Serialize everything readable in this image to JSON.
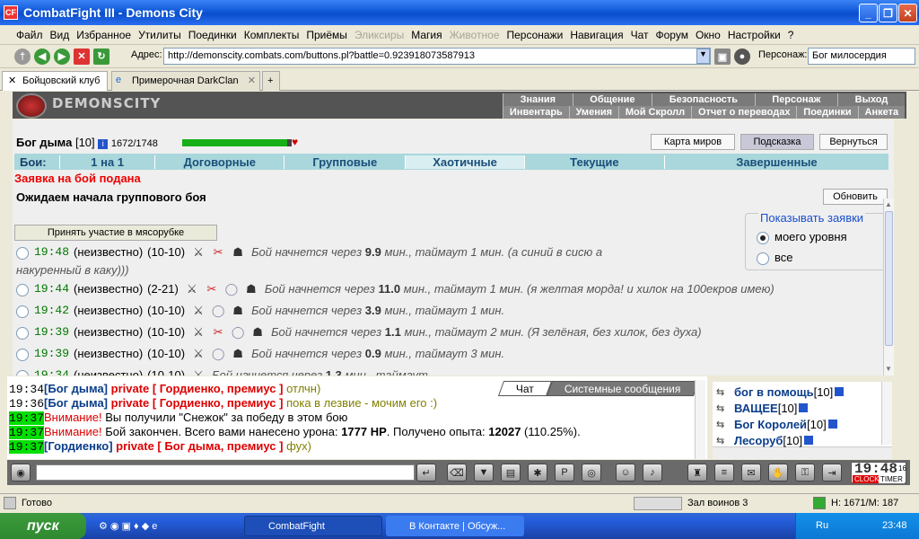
{
  "window": {
    "title": "CombatFight III - Demons City"
  },
  "menu": [
    {
      "label": "Файл",
      "disabled": false
    },
    {
      "label": "Вид",
      "disabled": false
    },
    {
      "label": "Избранное",
      "disabled": false
    },
    {
      "label": "Утилиты",
      "disabled": false
    },
    {
      "label": "Поединки",
      "disabled": false
    },
    {
      "label": "Комплекты",
      "disabled": false
    },
    {
      "label": "Приёмы",
      "disabled": false
    },
    {
      "label": "Эликсиры",
      "disabled": true
    },
    {
      "label": "Магия",
      "disabled": false
    },
    {
      "label": "Животное",
      "disabled": true
    },
    {
      "label": "Персонажи",
      "disabled": false
    },
    {
      "label": "Навигация",
      "disabled": false
    },
    {
      "label": "Чат",
      "disabled": false
    },
    {
      "label": "Форум",
      "disabled": false
    },
    {
      "label": "Окно",
      "disabled": false
    },
    {
      "label": "Настройки",
      "disabled": false
    },
    {
      "label": "?",
      "disabled": false
    }
  ],
  "toolbar": {
    "address_label": "Адрес:",
    "address": "http://demonscity.combats.com/buttons.pl?battle=0.923918073587913",
    "persona_label": "Персонаж:",
    "persona": "Бог милосердия"
  },
  "tabs": [
    {
      "label": "Бойцовский клуб",
      "active": true
    },
    {
      "label": "Примерочная DarkClan",
      "active": false
    }
  ],
  "site": {
    "logo": "DEMONSCITY",
    "nav1": [
      "Знания",
      "Общение",
      "Безопасность",
      "Персонаж",
      "Выход"
    ],
    "nav2": [
      "Инвентарь",
      "Умения",
      "Мой Скролл",
      "Отчет о переводах",
      "Поединки",
      "Анкета"
    ]
  },
  "player": {
    "name": "Бог дыма",
    "level": "[10]",
    "info_icon": "i",
    "hp": "1672/1748",
    "hp_fraction": 0.956,
    "heart": "♥"
  },
  "buttons": {
    "map": "Карта миров",
    "hint": "Подсказка",
    "back": "Вернуться",
    "refresh": "Обновить",
    "join": "Принять участие в мясорубке"
  },
  "fight_tabs": {
    "label": "Бои:",
    "items": [
      "1 на 1",
      "Договорные",
      "Групповые",
      "Хаотичные",
      "Текущие",
      "Завершенные"
    ],
    "active": 3
  },
  "status": {
    "submitted": "Заявка на бой подана",
    "waiting": "Ожидаем начала группового боя"
  },
  "filter": {
    "title": "Показывать заявки",
    "options": [
      "моего уровня",
      "все"
    ],
    "selected": 0
  },
  "requests": [
    {
      "time": "19:48",
      "who": "(неизвестно)",
      "levels": "(10-10)",
      "icons": [
        "crossed-swords",
        "blade-red",
        "helmet-dark"
      ],
      "pre": "Бой начнется через ",
      "num": "9.9",
      "post": " мин., таймаут 1 мин. (а синий в сисю а",
      "line2": "накуренный в каку)))"
    },
    {
      "time": "19:44",
      "who": "(неизвестно)",
      "levels": "(2-21)",
      "icons": [
        "crossed-swords",
        "blade-red",
        "orb",
        "helmet-dark"
      ],
      "pre": "Бой начнется через ",
      "num": "11.0",
      "post": " мин., таймаут 1 мин. (я желтая морда! и хилок на 100екров имею)",
      "line2": ""
    },
    {
      "time": "19:42",
      "who": "(неизвестно)",
      "levels": "(10-10)",
      "icons": [
        "crossed-swords",
        "orb",
        "helmet-dark"
      ],
      "pre": "Бой начнется через ",
      "num": "3.9",
      "post": " мин., таймаут 1 мин.",
      "line2": ""
    },
    {
      "time": "19:39",
      "who": "(неизвестно)",
      "levels": "(10-10)",
      "icons": [
        "crossed-swords",
        "blade-red",
        "orb",
        "helmet-dark"
      ],
      "pre": "Бой начнется через ",
      "num": "1.1",
      "post": " мин., таймаут 2 мин. (Я зелёная, без хилок, без духа)",
      "line2": ""
    },
    {
      "time": "19:39",
      "who": "(неизвестно)",
      "levels": "(10-10)",
      "icons": [
        "crossed-swords",
        "orb",
        "helmet-dark"
      ],
      "pre": "Бой начнется через ",
      "num": "0.9",
      "post": " мин., таймаут 3 мин.",
      "line2": ""
    },
    {
      "time": "19:34",
      "who": "(неизвестно)",
      "levels": "(10-10)",
      "icons": [
        "crossed-swords"
      ],
      "pre": "Бой начнется через ",
      "num": "1.3",
      "post": " мин., таймаут",
      "line2": ""
    }
  ],
  "chat": {
    "tabs": [
      "Чат",
      "Системные сообщения"
    ],
    "lines": [
      {
        "time": "19:34",
        "hl": false,
        "parts": [
          {
            "t": "[Бог дыма]",
            "c": "bl"
          },
          {
            "t": " private [ Гордиенко, премиус ]",
            "c": "rd"
          },
          {
            "t": " отлчн)",
            "c": "ol"
          }
        ]
      },
      {
        "time": "19:36",
        "hl": false,
        "parts": [
          {
            "t": "[Бог дыма]",
            "c": "bl"
          },
          {
            "t": " private [ Гордиенко, премиус ]",
            "c": "rd"
          },
          {
            "t": " пока в лезвие - мочим его :)",
            "c": "ol"
          }
        ]
      },
      {
        "time": "19:37",
        "hl": true,
        "parts": [
          {
            "t": "Внимание!",
            "c": "rdn"
          },
          {
            "t": " Вы получили \"Снежок\" за победу в этом бою",
            "c": ""
          }
        ]
      },
      {
        "time": "19:37",
        "hl": true,
        "parts": [
          {
            "t": "Внимание!",
            "c": "rdn"
          },
          {
            "t": " Бой закончен. Всего вами нанесено урона: ",
            "c": ""
          },
          {
            "t": "1777 HP",
            "c": "b"
          },
          {
            "t": ". Получено опыта: ",
            "c": ""
          },
          {
            "t": "12027",
            "c": "b"
          },
          {
            "t": " (110.25%).",
            "c": ""
          }
        ]
      },
      {
        "time": "19:37",
        "hl": true,
        "parts": [
          {
            "t": "[Гордиенко]",
            "c": "bl"
          },
          {
            "t": " private [ Бог дыма, премиус ]",
            "c": "rd"
          },
          {
            "t": " фух)",
            "c": "ol"
          }
        ]
      }
    ]
  },
  "users": [
    {
      "name": "бог в помощь",
      "level": "[10]"
    },
    {
      "name": "ВАЩЕЕ",
      "level": "[10]"
    },
    {
      "name": "Бог Королей",
      "level": "[10]"
    },
    {
      "name": "Лесоруб",
      "level": "[10]"
    }
  ],
  "clock": {
    "time": "19:48",
    "sec": "16",
    "clock_label": "CLOCK",
    "timer_label": "TIMER"
  },
  "statusbar": {
    "ready": "Готово",
    "room": "Зал воинов 3",
    "hp": "H: 1671/M: 187"
  },
  "taskbar": {
    "start": "пуск",
    "tasks": [
      "CombatFight",
      "В Контакте | Обсуж..."
    ],
    "lang": "Ru",
    "time": "23:48"
  }
}
